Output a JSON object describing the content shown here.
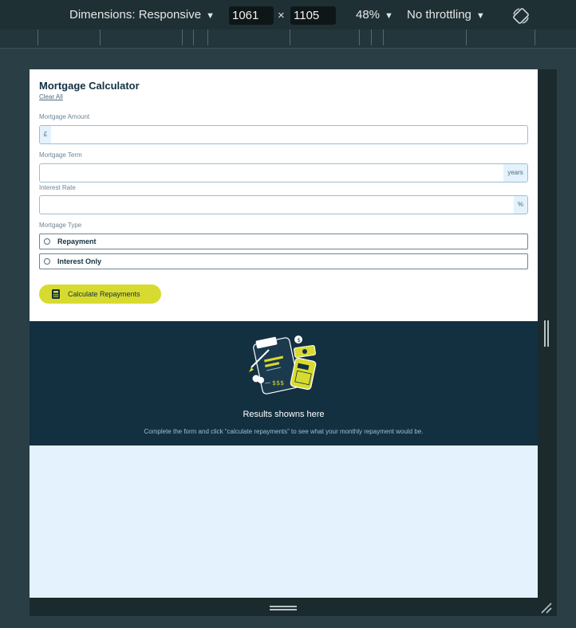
{
  "devtools": {
    "dimensions_label": "Dimensions: Responsive",
    "width_value": "1061",
    "times_symbol": "×",
    "height_value": "1105",
    "zoom_label": "48%",
    "throttle_label": "No throttling",
    "caret": "▼"
  },
  "calculator": {
    "title": "Mortgage Calculator",
    "clear_label": "Clear All",
    "amount": {
      "label": "Mortgage Amount",
      "prefix": "£",
      "value": ""
    },
    "term": {
      "label": "Mortgage Term",
      "suffix": "years",
      "value": ""
    },
    "rate": {
      "label": "Interest Rate",
      "suffix": "%",
      "value": ""
    },
    "type": {
      "label": "Mortgage Type",
      "options": [
        {
          "label": "Repayment",
          "selected": false
        },
        {
          "label": "Interest Only",
          "selected": false
        }
      ]
    },
    "submit_label": "Calculate Repayments"
  },
  "results": {
    "title": "Results showns here",
    "description": "Complete the form and click “calculate repayments” to see what your monthly repayment would be."
  },
  "colors": {
    "lime": "#d8db2f",
    "slate_900": "#133041",
    "slate_100": "#e3f2fc",
    "slate_300": "#9abed5",
    "devtools_bg": "#2a3f45"
  },
  "icons": [
    "rotate-icon",
    "calculator-icon",
    "results-illustration",
    "drag-handle-icon",
    "resize-grip-icon"
  ]
}
